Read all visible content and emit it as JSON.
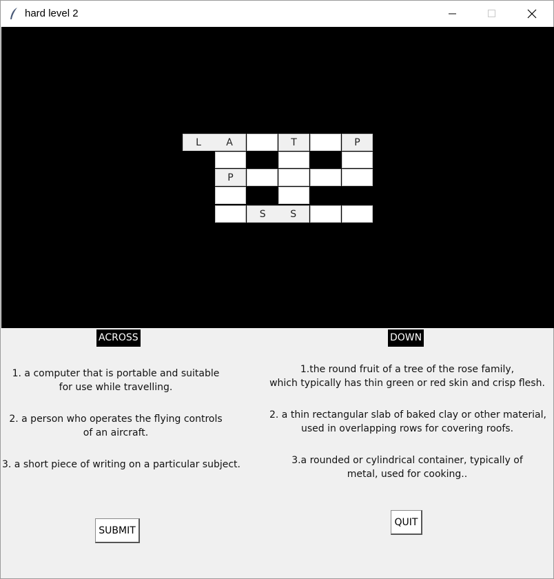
{
  "window": {
    "title": "hard level 2"
  },
  "board": {
    "rows": [
      [
        "L",
        "A",
        "",
        "T",
        "",
        "P"
      ],
      [
        "",
        "",
        ""
      ],
      [
        "P",
        "",
        "",
        "",
        ""
      ],
      [
        "",
        ""
      ],
      [
        "",
        "S",
        "S",
        "",
        ""
      ]
    ]
  },
  "across": {
    "heading": "ACROSS",
    "clues": [
      [
        "1. a computer that is portable and suitable",
        "for use while travelling."
      ],
      [
        "2. a person who operates the flying controls",
        "of an aircraft."
      ],
      [
        "3.  a short piece of writing on a particular subject."
      ]
    ]
  },
  "down": {
    "heading": "DOWN",
    "clues": [
      [
        "1.the round fruit of a tree of the rose family,",
        "which typically has thin green or red skin and crisp flesh."
      ],
      [
        "2. a thin rectangular slab of baked clay or other material,",
        "used in overlapping rows for covering roofs."
      ],
      [
        "3.a rounded or cylindrical container, typically of",
        "metal, used for cooking.."
      ]
    ]
  },
  "buttons": {
    "submit": "SUBMIT",
    "quit": "QUIT"
  },
  "icons": {
    "app": "feather-icon",
    "minimize": "minimize-icon",
    "maximize": "maximize-icon",
    "close": "close-icon"
  }
}
